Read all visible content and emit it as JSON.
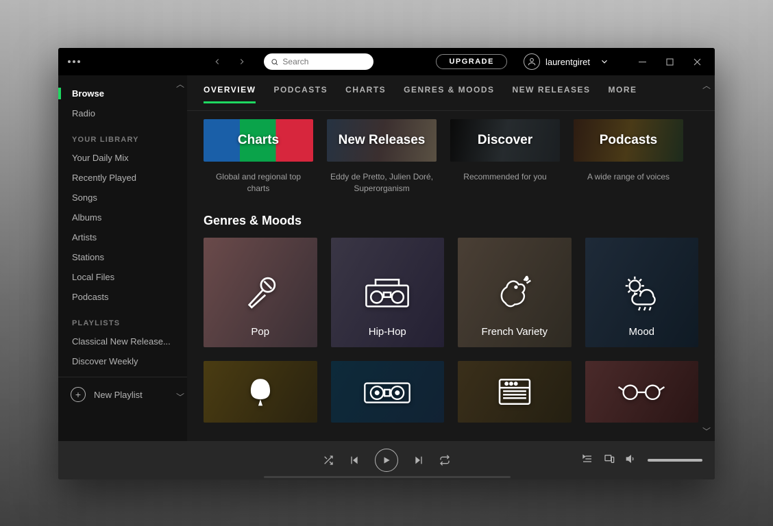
{
  "titlebar": {
    "search_placeholder": "Search",
    "upgrade": "UPGRADE",
    "username": "laurentgiret"
  },
  "sidebar": {
    "main": [
      "Browse",
      "Radio"
    ],
    "library_header": "YOUR LIBRARY",
    "library": [
      "Your Daily Mix",
      "Recently Played",
      "Songs",
      "Albums",
      "Artists",
      "Stations",
      "Local Files",
      "Podcasts"
    ],
    "playlists_header": "PLAYLISTS",
    "playlists": [
      "Classical New Release...",
      "Discover Weekly"
    ],
    "new_playlist": "New Playlist"
  },
  "tabs": [
    "OVERVIEW",
    "PODCASTS",
    "CHARTS",
    "GENRES & MOODS",
    "NEW RELEASES",
    "MORE"
  ],
  "hero": [
    {
      "title": "Charts",
      "sub": "Global and regional top charts"
    },
    {
      "title": "New Releases",
      "sub": "Eddy de Pretto, Julien Doré, Superorganism"
    },
    {
      "title": "Discover",
      "sub": "Recommended for you"
    },
    {
      "title": "Podcasts",
      "sub": "A wide range of voices"
    }
  ],
  "section_title": "Genres & Moods",
  "genres": [
    "Pop",
    "Hip-Hop",
    "French Variety",
    "Mood"
  ]
}
